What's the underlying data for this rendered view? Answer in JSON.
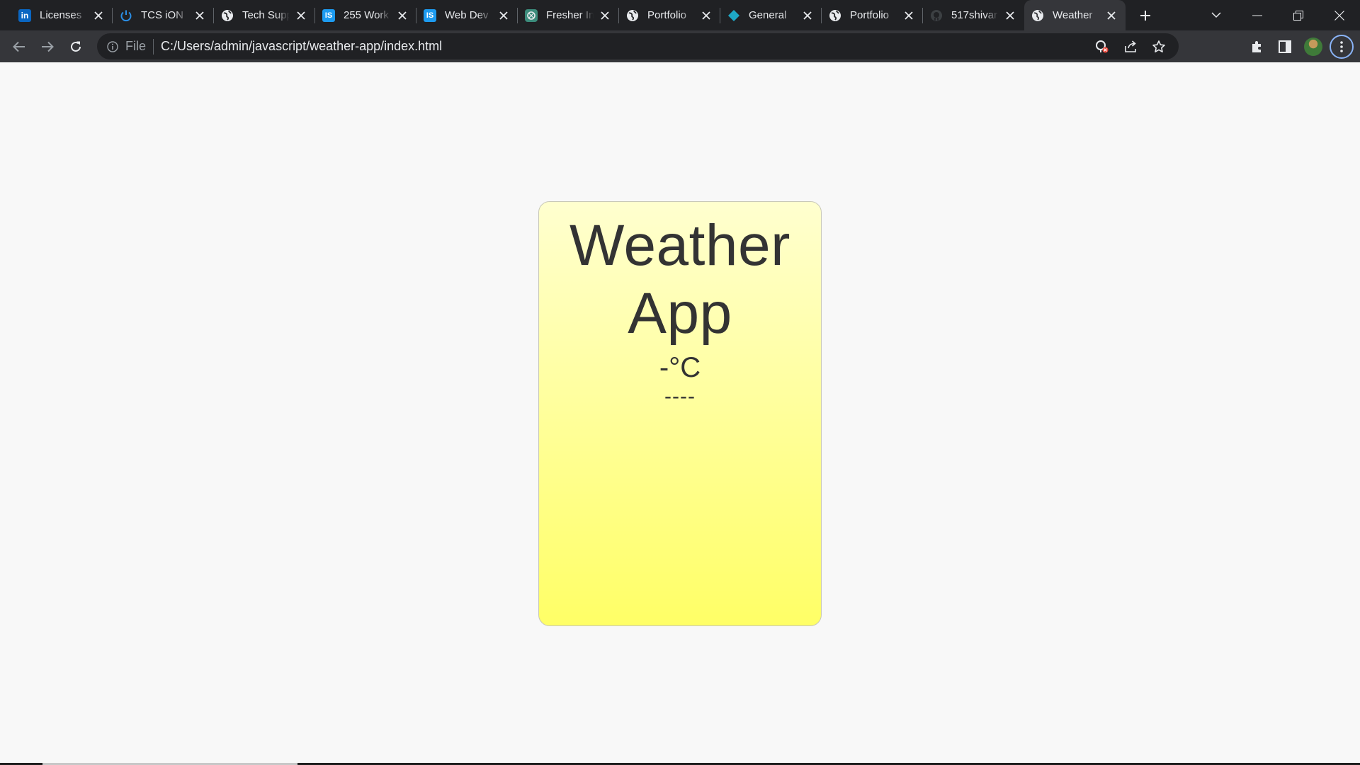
{
  "browser": {
    "tabs": [
      {
        "title": "Licenses",
        "favicon": "linkedin-icon",
        "active": false
      },
      {
        "title": "TCS iON",
        "favicon": "power-icon",
        "active": false
      },
      {
        "title": "Tech Supp",
        "favicon": "globe-icon",
        "active": false
      },
      {
        "title": "255 Work",
        "favicon": "is-icon",
        "active": false
      },
      {
        "title": "Web Dev",
        "favicon": "is-icon",
        "active": false
      },
      {
        "title": "Fresher In",
        "favicon": "openai-icon",
        "active": false
      },
      {
        "title": "Portfolio",
        "favicon": "globe-icon",
        "active": false
      },
      {
        "title": "General",
        "favicon": "diamond-icon",
        "active": false
      },
      {
        "title": "Portfolio",
        "favicon": "globe-icon",
        "active": false
      },
      {
        "title": "517shivar",
        "favicon": "github-icon",
        "active": false
      },
      {
        "title": "Weather",
        "favicon": "globe-icon",
        "active": true
      }
    ],
    "address_bar": {
      "scheme_label": "File",
      "url": "C:/Users/admin/javascript/weather-app/index.html"
    },
    "colors": {
      "tabstrip": "#202124",
      "toolbar": "#35363a",
      "omnibox": "#202124",
      "accent": "#8ab4f8"
    }
  },
  "app": {
    "title_line1": "Weather",
    "title_line2": "App",
    "temperature": "-°C",
    "description": "----",
    "colors": {
      "card_top": "#ffffcf",
      "card_bottom": "#ffff66",
      "text": "#333333",
      "page_background": "#f8f8f8"
    }
  }
}
